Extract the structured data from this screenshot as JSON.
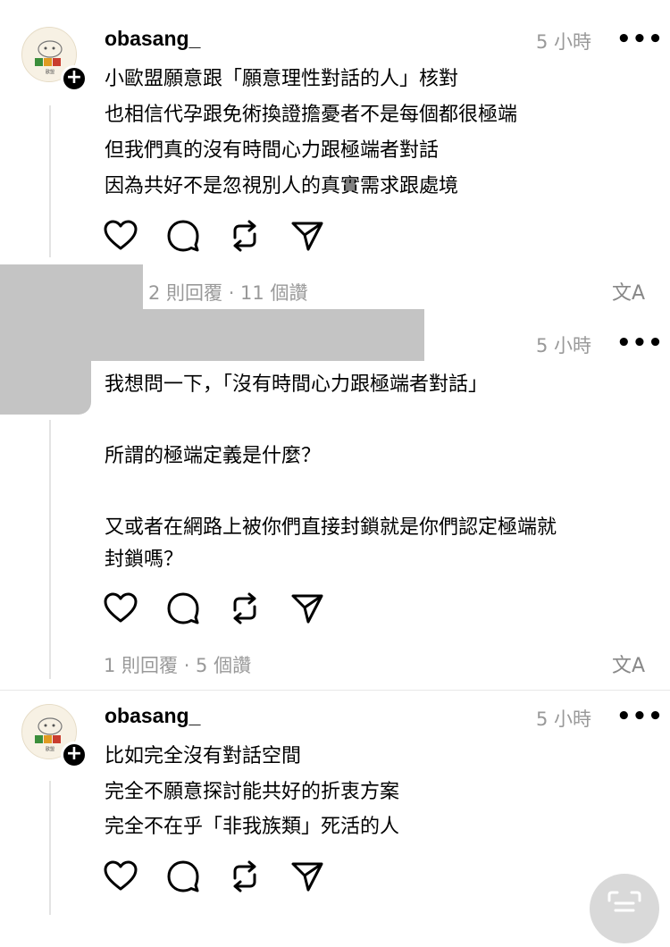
{
  "posts": [
    {
      "username": "obasang_",
      "time": "5 小時",
      "more": "•••",
      "lines": [
        "小歐盟願意跟「願意理性對話的人」核對",
        "也相信代孕跟免術換證擔憂者不是每個都很極端",
        "但我們真的沒有時間心力跟極端者對話",
        "因為共好不是忽視別人的真實需求跟處境"
      ],
      "meta": "2 則回覆 · 11 個讚"
    },
    {
      "time": "5 小時",
      "more": "•••",
      "lines": [
        "我想問一下，「沒有時間心力跟極端者對話」",
        "",
        "所謂的極端定義是什麼？",
        "",
        "又或者在網路上被你們直接封鎖就是你們認定極端就",
        "封鎖嗎？"
      ],
      "meta": "1 則回覆 · 5 個讚"
    },
    {
      "username": "obasang_",
      "time": "5 小時",
      "more": "•••",
      "lines": [
        "比如完全沒有對話空間",
        "完全不願意探討能共好的折衷方案",
        "完全不在乎「非我族類」死活的人"
      ]
    }
  ],
  "avatar_text": "歐盟",
  "plus": "+",
  "translate_icon": "文A",
  "icons": [
    "heart-icon",
    "comment-icon",
    "repost-icon",
    "share-icon",
    "translate-icon"
  ]
}
